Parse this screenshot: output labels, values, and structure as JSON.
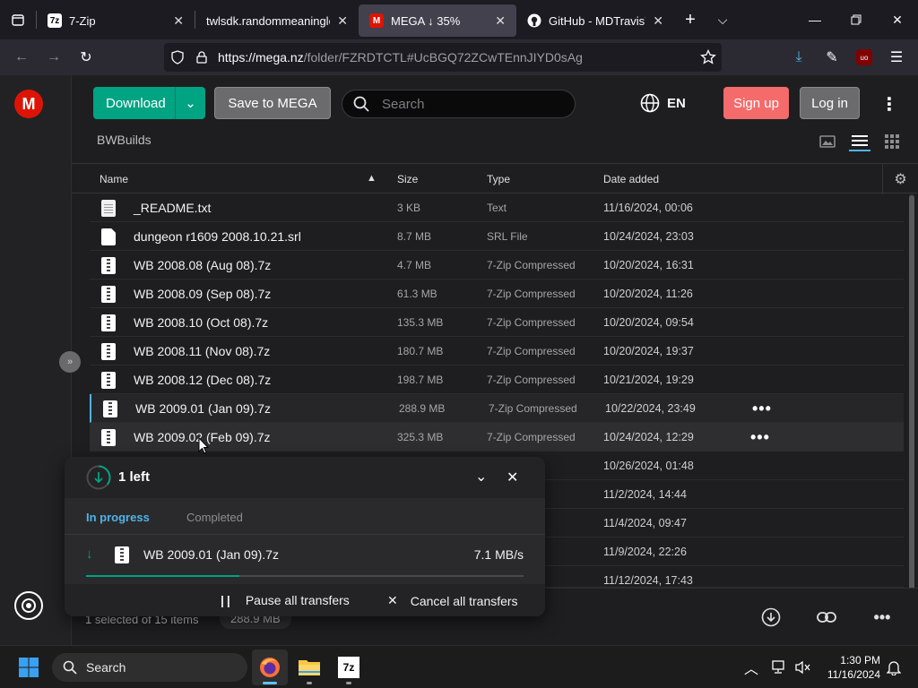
{
  "browser": {
    "tabs": [
      {
        "title": "7-Zip",
        "favicon": "7z"
      },
      {
        "title": "twlsdk.randommeaningles",
        "favicon": ""
      },
      {
        "title": "MEGA ↓ 35%",
        "favicon": "M"
      },
      {
        "title": "GitHub - MDTravisYT/r",
        "favicon": "github"
      }
    ],
    "url_host": "https://mega.nz",
    "url_path": "/folder/FZRDTCTL#UcBGQ72ZCwTEnnJIYD0sAg"
  },
  "mega": {
    "download_label": "Download",
    "save_label": "Save to MEGA",
    "search_placeholder": "Search",
    "language": "EN",
    "signup_label": "Sign up",
    "login_label": "Log in",
    "breadcrumb": "BWBuilds",
    "columns": {
      "name": "Name",
      "size": "Size",
      "type": "Type",
      "date": "Date added"
    },
    "files": [
      {
        "name": "_README.txt",
        "size": "3 KB",
        "type": "Text",
        "date": "11/16/2024, 00:06",
        "icon": "text-file-icon"
      },
      {
        "name": "dungeon r1609 2008.10.21.srl",
        "size": "8.7 MB",
        "type": "SRL File",
        "date": "10/24/2024, 23:03",
        "icon": "generic-file-icon"
      },
      {
        "name": "WB 2008.08 (Aug 08).7z",
        "size": "4.7 MB",
        "type": "7-Zip Compressed",
        "date": "10/20/2024, 16:31",
        "icon": "archive-icon"
      },
      {
        "name": "WB 2008.09 (Sep 08).7z",
        "size": "61.3 MB",
        "type": "7-Zip Compressed",
        "date": "10/20/2024, 11:26",
        "icon": "archive-icon"
      },
      {
        "name": "WB 2008.10 (Oct 08).7z",
        "size": "135.3 MB",
        "type": "7-Zip Compressed",
        "date": "10/20/2024, 09:54",
        "icon": "archive-icon"
      },
      {
        "name": "WB 2008.11 (Nov 08).7z",
        "size": "180.7 MB",
        "type": "7-Zip Compressed",
        "date": "10/20/2024, 19:37",
        "icon": "archive-icon"
      },
      {
        "name": "WB 2008.12 (Dec 08).7z",
        "size": "198.7 MB",
        "type": "7-Zip Compressed",
        "date": "10/21/2024, 19:29",
        "icon": "archive-icon"
      },
      {
        "name": "WB 2009.01 (Jan 09).7z",
        "size": "288.9 MB",
        "type": "7-Zip Compressed",
        "date": "10/22/2024, 23:49",
        "icon": "archive-icon"
      },
      {
        "name": "WB 2009.02 (Feb 09).7z",
        "size": "325.3 MB",
        "type": "7-Zip Compressed",
        "date": "10/24/2024, 12:29",
        "icon": "archive-icon"
      },
      {
        "name": "",
        "size": "",
        "type": "ressed",
        "date": "10/26/2024, 01:48",
        "icon": "archive-icon"
      },
      {
        "name": "",
        "size": "",
        "type": "ressed",
        "date": "11/2/2024, 14:44",
        "icon": "archive-icon"
      },
      {
        "name": "",
        "size": "",
        "type": "ressed",
        "date": "11/4/2024, 09:47",
        "icon": "archive-icon"
      },
      {
        "name": "",
        "size": "",
        "type": "ressed",
        "date": "11/9/2024, 22:26",
        "icon": "archive-icon"
      },
      {
        "name": "",
        "size": "",
        "type": "ressed",
        "date": "11/12/2024, 17:43",
        "icon": "archive-icon"
      }
    ],
    "footer": {
      "selection": "1 selected of 15 items",
      "selection_size": "288.9 MB"
    },
    "transfers": {
      "count_label": "1 left",
      "tab_in_progress": "In progress",
      "tab_completed": "Completed",
      "file": "WB 2009.01 (Jan 09).7z",
      "speed": "7.1 MB/s",
      "progress": 0.35,
      "pause_label": "Pause all transfers",
      "cancel_label": "Cancel all transfers"
    },
    "colors": {
      "accent": "#00a382",
      "brand": "#dd1405",
      "signup": "#f46b6b",
      "link_blue": "#4fb3e8"
    }
  },
  "taskbar": {
    "search_label": "Search",
    "time": "1:30 PM",
    "date": "11/16/2024"
  }
}
